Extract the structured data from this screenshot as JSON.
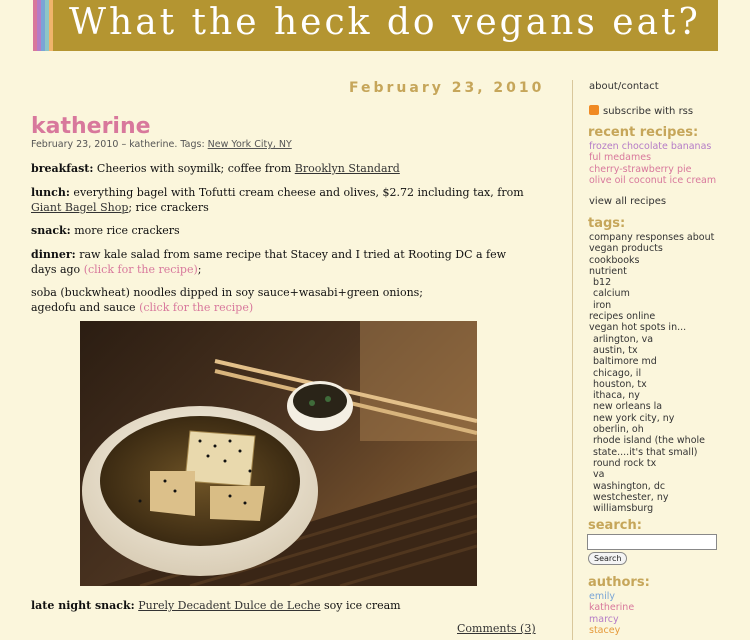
{
  "site": {
    "title": "What the heck do vegans eat?",
    "stripe_colors": [
      "#d8789c",
      "#b57cc7",
      "#7aa5d6",
      "#8ec6c6",
      "#f0b46b"
    ]
  },
  "post": {
    "date": "February 23, 2010",
    "title": "katherine",
    "meta_prefix": "February 23, 2010 – katherine.  Tags:",
    "meta_tag": "New York City, NY",
    "breakfast_label": "breakfast:",
    "breakfast_text": " Cheerios with soymilk; coffee from ",
    "breakfast_link": "Brooklyn Standard",
    "lunch_label": "lunch:",
    "lunch_text": " everything bagel with Tofutti cream cheese and olives, $2.72 including tax, from ",
    "lunch_link": "Giant Bagel Shop",
    "lunch_after": "; rice crackers",
    "snack_label": "snack:",
    "snack_text": " more rice crackers",
    "dinner_label": "dinner:",
    "dinner_text": " raw kale salad from same recipe that Stacey and I tried at Rooting DC a few days ago ",
    "dinner_link": "(click for the recipe)",
    "dinner_after": ";",
    "soba_line1": "soba (buckwheat) noodles dipped in soy sauce+wasabi+green onions;",
    "soba_line2": "agedofu and sauce ",
    "soba_link": "(click for the recipe)",
    "late_label": "late night snack:",
    "late_link": "Purely Decadent Dulce de Leche",
    "late_after": " soy ice cream",
    "comments": "Comments (3)"
  },
  "sidebar": {
    "about": "about/contact",
    "rss": "subscribe with rss",
    "recent_heading": "recent recipes:",
    "recent": [
      {
        "label": "frozen chocolate bananas",
        "color": "#b57cc7"
      },
      {
        "label": "ful medames",
        "color": "#d8789c"
      },
      {
        "label": "cherry-strawberry pie",
        "color": "#d8789c"
      },
      {
        "label": "olive oil coconut ice cream",
        "color": "#d8789c"
      }
    ],
    "view_all": "view all recipes",
    "tags_heading": "tags:",
    "tags": [
      {
        "label": "company responses about",
        "indent": false
      },
      {
        "label": "vegan products",
        "indent": false
      },
      {
        "label": "cookbooks",
        "indent": false
      },
      {
        "label": "nutrient",
        "indent": false
      },
      {
        "label": "b12",
        "indent": true
      },
      {
        "label": "calcium",
        "indent": true
      },
      {
        "label": "iron",
        "indent": true
      },
      {
        "label": "recipes online",
        "indent": false
      },
      {
        "label": "vegan hot spots in...",
        "indent": false
      },
      {
        "label": "arlington, va",
        "indent": true
      },
      {
        "label": "austin, tx",
        "indent": true
      },
      {
        "label": "baltimore md",
        "indent": true
      },
      {
        "label": "chicago, il",
        "indent": true
      },
      {
        "label": "houston, tx",
        "indent": true
      },
      {
        "label": "ithaca, ny",
        "indent": true
      },
      {
        "label": "new orleans la",
        "indent": true
      },
      {
        "label": "new york city, ny",
        "indent": true
      },
      {
        "label": "oberlin, oh",
        "indent": true
      },
      {
        "label": "rhode island (the whole",
        "indent": true
      },
      {
        "label": "state....it's that small)",
        "indent": true
      },
      {
        "label": "round rock tx",
        "indent": true
      },
      {
        "label": "va",
        "indent": true
      },
      {
        "label": "washington, dc",
        "indent": true
      },
      {
        "label": "westchester, ny",
        "indent": true
      },
      {
        "label": "williamsburg",
        "indent": true
      }
    ],
    "search_heading": "search:",
    "search_button": "Search",
    "authors_heading": "authors:",
    "authors": [
      {
        "label": "emily",
        "color": "#7aa5d6"
      },
      {
        "label": "katherine",
        "color": "#d8789c"
      },
      {
        "label": "marcy",
        "color": "#b57cc7"
      },
      {
        "label": "stacey",
        "color": "#e59a3b"
      }
    ]
  }
}
